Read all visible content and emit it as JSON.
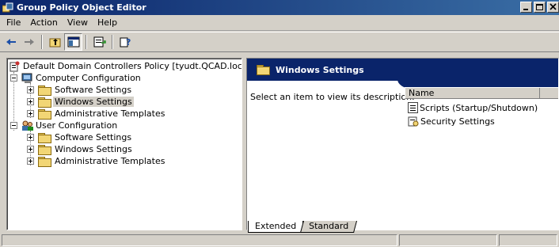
{
  "window": {
    "title": "Group Policy Object Editor"
  },
  "menu": {
    "items": [
      {
        "label": "File"
      },
      {
        "label": "Action"
      },
      {
        "label": "View"
      },
      {
        "label": "Help"
      }
    ]
  },
  "toolbar": {
    "buttons": [
      "back-arrow-icon",
      "forward-arrow-icon",
      "up-folder-icon",
      "show-hide-tree-icon",
      "export-list-icon",
      "help-icon"
    ]
  },
  "tree": {
    "root": "Default Domain Controllers Policy [tyudt.QCAD.local] Policy",
    "computer_config": "Computer Configuration",
    "cc_software": "Software Settings",
    "cc_windows": "Windows Settings",
    "cc_admin": "Administrative Templates",
    "user_config": "User Configuration",
    "uc_software": "Software Settings",
    "uc_windows": "Windows Settings",
    "uc_admin": "Administrative Templates",
    "selected": "Windows Settings"
  },
  "right": {
    "header": "Windows Settings",
    "description": "Select an item to view its description.",
    "column_name": "Name",
    "items": [
      {
        "label": "Scripts (Startup/Shutdown)",
        "icon": "script-icon"
      },
      {
        "label": "Security Settings",
        "icon": "security-icon"
      }
    ]
  },
  "tabs": {
    "extended": "Extended",
    "standard": "Standard",
    "active": "Extended"
  },
  "colors": {
    "title_bar": "#0a246a",
    "window_bg": "#d4d0c8",
    "folder": "#f2d675"
  }
}
